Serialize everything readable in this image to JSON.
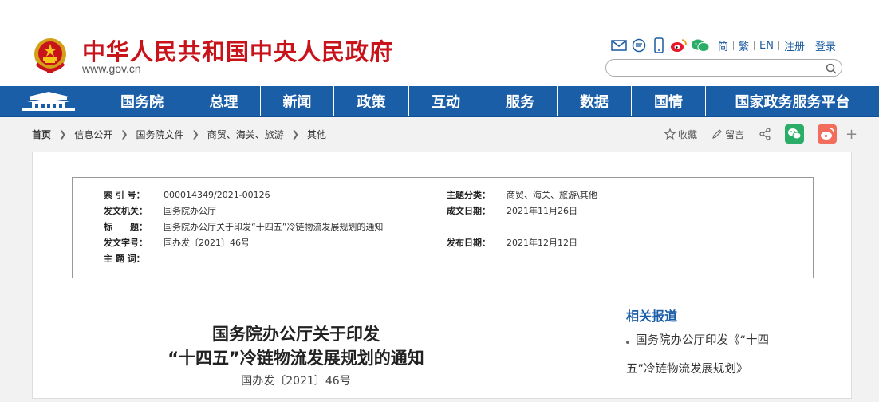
{
  "header": {
    "site_title": "中华人民共和国中央人民政府",
    "site_url": "www.gov.cn",
    "links": [
      "简",
      "繁",
      "EN",
      "注册",
      "登录"
    ],
    "icons": [
      "mail-icon",
      "message-icon",
      "mobile-icon",
      "weibo-icon",
      "wechat-icon"
    ],
    "search_placeholder": ""
  },
  "nav": {
    "items": [
      "国务院",
      "总理",
      "新闻",
      "政策",
      "互动",
      "服务",
      "数据",
      "国情",
      "国家政务服务平台"
    ]
  },
  "breadcrumb": {
    "items": [
      "首页",
      "信息公开",
      "国务院文件",
      "商贸、海关、旅游",
      "其他"
    ]
  },
  "share": {
    "favorite": "收藏",
    "comment": "留言"
  },
  "meta": {
    "index_label": "索 引 号：",
    "index_value": "000014349/2021-00126",
    "category_label": "主题分类：",
    "category_value": "商贸、海关、旅游\\其他",
    "issuer_label": "发文机关：",
    "issuer_value": "国务院办公厅",
    "date_label": "成文日期：",
    "date_value": "2021年11月26日",
    "title_label": "标　　题：",
    "title_value": "国务院办公厅关于印发“十四五”冷链物流发展规划的通知",
    "doc_label": "发文字号：",
    "doc_value": "国办发〔2021〕46号",
    "publish_label": "发布日期：",
    "publish_value": "2021年12月12日",
    "subject_label": "主 题 词：",
    "subject_value": ""
  },
  "article": {
    "title_line1": "国务院办公厅关于印发",
    "title_line2": "“十四五”冷链物流发展规划的通知",
    "doc_no": "国办发〔2021〕46号"
  },
  "related": {
    "heading": "相关报道",
    "line1": "国务院办公厅印发《“十四",
    "line2": "五”冷链物流发展规划》"
  },
  "colors": {
    "brand_red": "#c8131b",
    "nav_blue": "#1a5ea8",
    "link_blue": "#1a5b9f"
  }
}
